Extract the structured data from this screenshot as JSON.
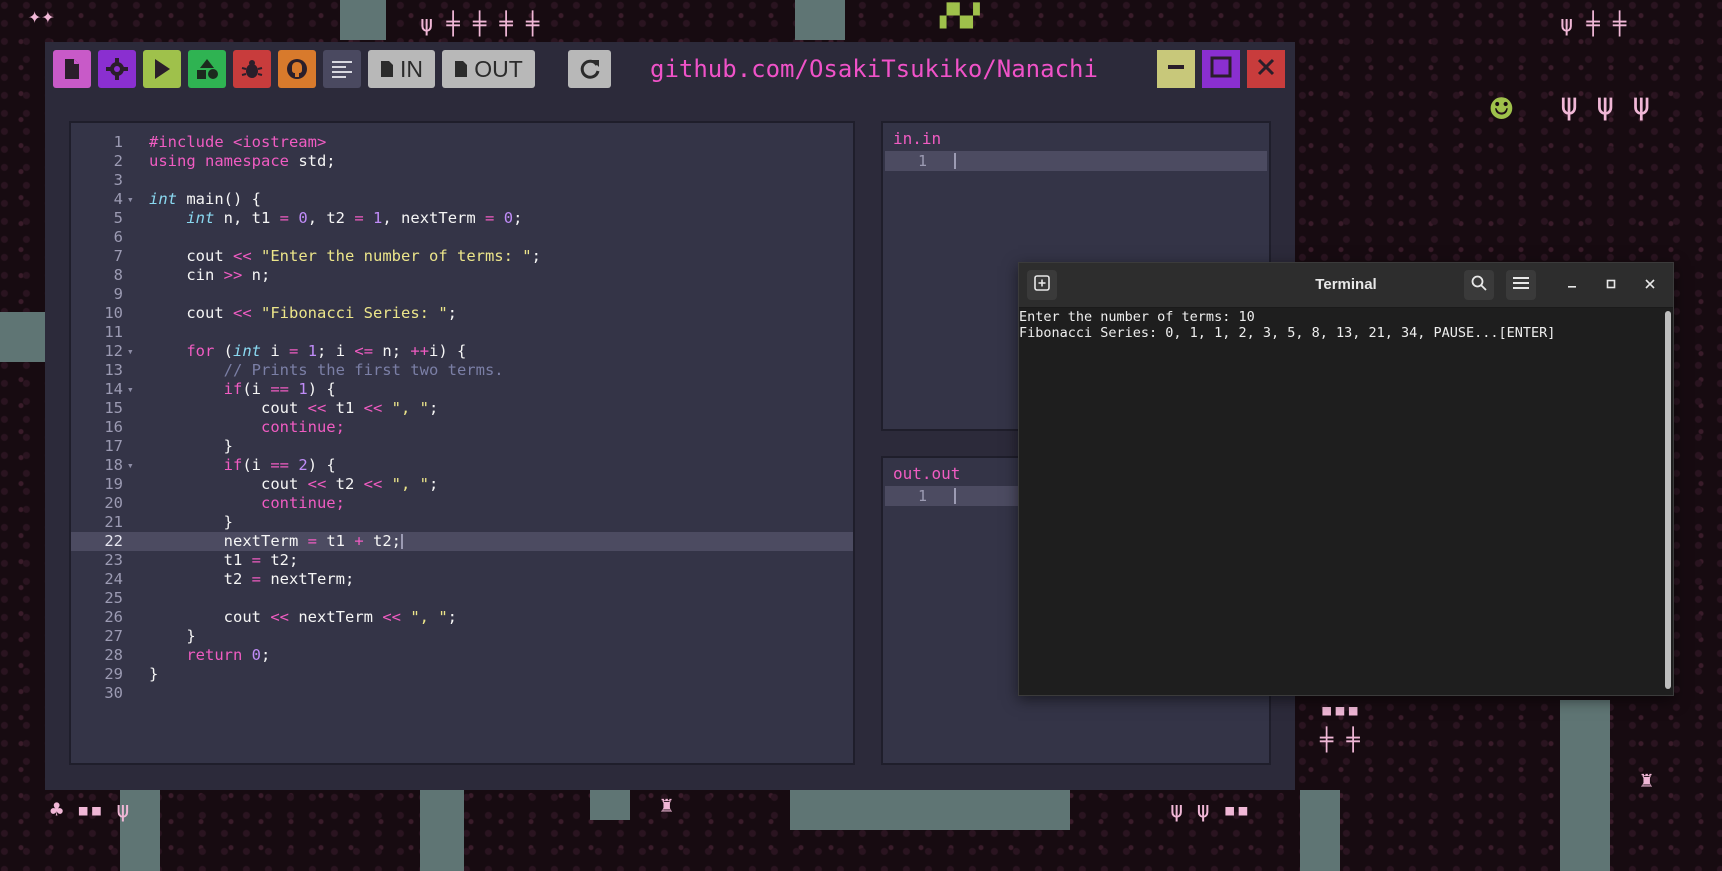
{
  "app": {
    "repo_url": "github.com/OsakiTsukiko/Nanachi",
    "toolbar": {
      "in_label": "IN",
      "out_label": "OUT"
    },
    "colors": {
      "accent": "#f052c8",
      "btn_new": "#c85ac8",
      "btn_settings": "#8a2fd0",
      "btn_run": "#9fc14b",
      "btn_tree": "#2fb352",
      "btn_debug": "#c83c3c",
      "btn_github": "#d87a2c",
      "btn_format": "#4a4960",
      "btn_io": "#b8b8b8",
      "btn_minimize": "#c8c87a",
      "btn_maximize": "#8a2fd0",
      "btn_close": "#c83c3c"
    }
  },
  "editor": {
    "current_line": 22,
    "lines": [
      "1",
      "2",
      "3",
      "4",
      "5",
      "6",
      "7",
      "8",
      "9",
      "10",
      "11",
      "12",
      "13",
      "14",
      "15",
      "16",
      "17",
      "18",
      "19",
      "20",
      "21",
      "22",
      "23",
      "24",
      "25",
      "26",
      "27",
      "28",
      "29",
      "30"
    ],
    "code": {
      "l1": "#include <iostream>",
      "l2_a": "using namespace",
      "l2_b": " std;",
      "l4_a": "int",
      "l4_b": " main() {",
      "l5_a": "int",
      "l5_b": " n, t1 ",
      "l5_c": "=",
      "l5_d": "0",
      "l5_e": ", t2 ",
      "l5_f": "=",
      "l5_g": "1",
      "l5_h": ", nextTerm ",
      "l5_i": "=",
      "l5_j": "0",
      "l5_k": ";",
      "l7_a": "cout ",
      "l7_b": "<<",
      "l7_c": "\"Enter the number of terms: \"",
      "l7_d": ";",
      "l8_a": "cin ",
      "l8_b": ">>",
      "l8_c": " n;",
      "l10_a": "cout ",
      "l10_b": "<<",
      "l10_c": "\"Fibonacci Series: \"",
      "l10_d": ";",
      "l12_a": "for",
      "l12_b": " (",
      "l12_c": "int",
      "l12_d": " i ",
      "l12_e": "=",
      "l12_f": "1",
      "l12_g": "; i ",
      "l12_h": "<=",
      "l12_i": " n; ",
      "l12_j": "++",
      "l12_k": "i) {",
      "l13": "// Prints the first two terms.",
      "l14_a": "if",
      "l14_b": "(i ",
      "l14_c": "==",
      "l14_d": "1",
      "l14_e": ") {",
      "l15_a": "cout ",
      "l15_b": "<<",
      "l15_c": " t1 ",
      "l15_d": "<<",
      "l15_e": "\", \"",
      "l15_f": ";",
      "l16": "continue;",
      "l17": "}",
      "l18_a": "if",
      "l18_b": "(i ",
      "l18_c": "==",
      "l18_d": "2",
      "l18_e": ") {",
      "l19_a": "cout ",
      "l19_b": "<<",
      "l19_c": " t2 ",
      "l19_d": "<<",
      "l19_e": "\", \"",
      "l19_f": ";",
      "l20": "continue;",
      "l21": "}",
      "l22_a": "nextTerm ",
      "l22_b": "=",
      "l22_c": " t1 ",
      "l22_d": "+",
      "l22_e": " t2;",
      "l23_a": "t1 ",
      "l23_b": "=",
      "l23_c": " t2;",
      "l24_a": "t2 ",
      "l24_b": "=",
      "l24_c": " nextTerm;",
      "l26_a": "cout ",
      "l26_b": "<<",
      "l26_c": " nextTerm ",
      "l26_d": "<<",
      "l26_e": "\", \"",
      "l26_f": ";",
      "l27": "}",
      "l28_a": "return",
      "l28_b": "0",
      "l28_c": ";",
      "l29": "}"
    }
  },
  "in_pane": {
    "title": "in.in",
    "line": "1"
  },
  "out_pane": {
    "title": "out.out",
    "line": "1"
  },
  "terminal": {
    "title": "Terminal",
    "lines": [
      "Enter the number of terms: 10",
      "Fibonacci Series: 0, 1, 1, 2, 3, 5, 8, 13, 21, 34, PAUSE...[ENTER]"
    ]
  }
}
